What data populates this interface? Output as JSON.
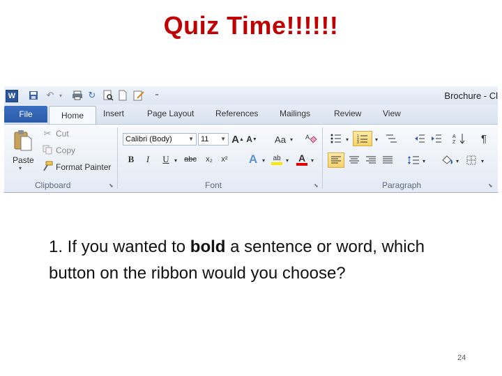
{
  "slide": {
    "title": "Quiz Time!!!!!!",
    "question_before": "1. If you wanted to ",
    "question_bold": "bold",
    "question_after": " a sentence or word, which button on the ribbon would you choose?",
    "page_number": "24"
  },
  "app": {
    "logo_letter": "W",
    "doc_title": "Brochure - Cl"
  },
  "tabs": [
    "File",
    "Home",
    "Insert",
    "Page Layout",
    "References",
    "Mailings",
    "Review",
    "View"
  ],
  "clipboard": {
    "paste_label": "Paste",
    "cut_label": "Cut",
    "copy_label": "Copy",
    "format_painter_label": "Format Painter",
    "group_label": "Clipboard"
  },
  "font": {
    "font_name": "Calibri (Body)",
    "font_size": "11",
    "bold_glyph": "B",
    "italic_glyph": "I",
    "underline_glyph": "U",
    "strike_glyph": "abc",
    "subscript_glyph": "x₂",
    "superscript_glyph": "x²",
    "grow_glyph": "A",
    "shrink_glyph": "A",
    "change_case_glyph": "Aa",
    "text_effects_glyph": "A",
    "highlight_glyph": "ab",
    "font_color_glyph": "A",
    "group_label": "Font"
  },
  "paragraph": {
    "group_label": "Paragraph",
    "pilcrow_glyph": "¶"
  },
  "colors": {
    "title_red": "#c00000",
    "ribbon_blue": "#2b579a",
    "highlight_yellow": "#ffe600",
    "font_color_red": "#e00000"
  }
}
